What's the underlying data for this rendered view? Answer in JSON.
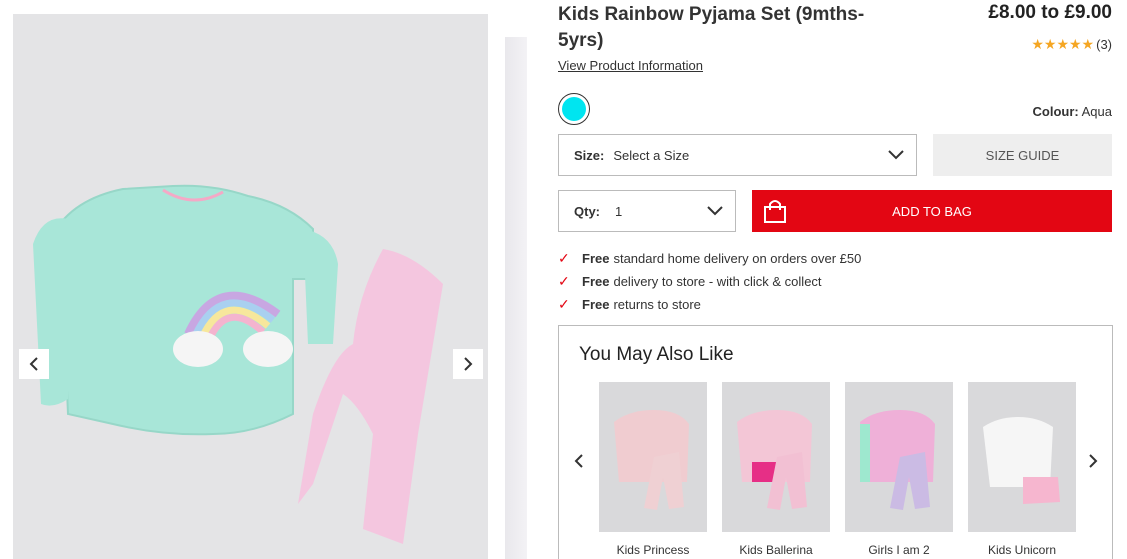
{
  "product": {
    "title": "Kids Rainbow Pyjama Set (9mths-5yrs)",
    "price": "£8.00 to £9.00",
    "stars": "★★★★★",
    "review_count": "(3)",
    "view_info": "View Product Information",
    "colour_label": "Colour:",
    "colour_value": "Aqua",
    "swatch_color": "#00e5f0"
  },
  "size": {
    "label": "Size:",
    "value": "Select a Size",
    "guide": "SIZE GUIDE"
  },
  "qty": {
    "label": "Qty:",
    "value": "1"
  },
  "add_to_bag": "ADD TO BAG",
  "benefits": [
    {
      "bold": "Free",
      "text": "standard home delivery on orders over £50"
    },
    {
      "bold": "Free",
      "text": "delivery to store - with click & collect"
    },
    {
      "bold": "Free",
      "text": "returns to store"
    }
  ],
  "recommendations": {
    "heading": "You May Also Like",
    "items": [
      {
        "name": "Kids Princess"
      },
      {
        "name": "Kids Ballerina"
      },
      {
        "name": "Girls I am 2"
      },
      {
        "name": "Kids Unicorn"
      }
    ]
  },
  "colors": {
    "accent": "#e30613",
    "star": "#f5a623"
  }
}
